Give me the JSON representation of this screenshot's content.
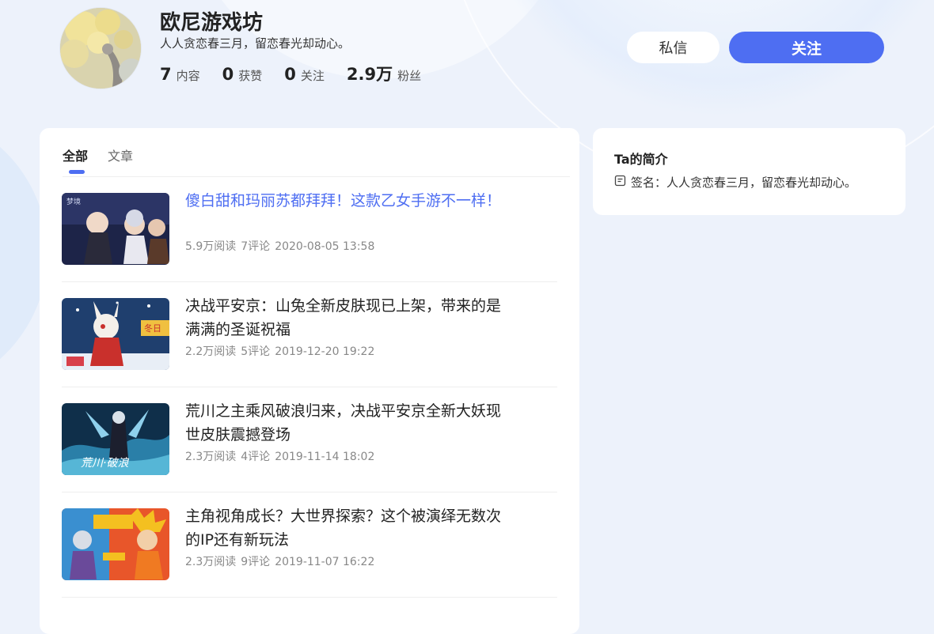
{
  "profile": {
    "name": "欧尼游戏坊",
    "signature": "人人贪恋春三月，留恋春光却动心。",
    "stats": [
      {
        "num": "7",
        "label": "内容"
      },
      {
        "num": "0",
        "label": "获赞"
      },
      {
        "num": "0",
        "label": "关注"
      },
      {
        "num": "2.9万",
        "label": "粉丝"
      }
    ]
  },
  "actions": {
    "message_label": "私信",
    "follow_label": "关注"
  },
  "tabs": [
    {
      "label": "全部",
      "active": true
    },
    {
      "label": "文章",
      "active": false
    }
  ],
  "articles": [
    {
      "title": "傻白甜和玛丽苏都拜拜！这款乙女手游不一样！",
      "reads": "5.9万阅读",
      "comments": "7评论",
      "date": "2020-08-05 13:58",
      "highlighted": true
    },
    {
      "title": "决战平安京：山兔全新皮肤现已上架，带来的是满满的圣诞祝福",
      "reads": "2.2万阅读",
      "comments": "5评论",
      "date": "2019-12-20 19:22",
      "highlighted": false
    },
    {
      "title": "荒川之主乘风破浪归来，决战平安京全新大妖现世皮肤震撼登场",
      "reads": "2.3万阅读",
      "comments": "4评论",
      "date": "2019-11-14 18:02",
      "highlighted": false
    },
    {
      "title": "主角视角成长？大世界探索？这个被演绎无数次的IP还有新玩法",
      "reads": "2.3万阅读",
      "comments": "9评论",
      "date": "2019-11-07 16:22",
      "highlighted": false
    }
  ],
  "sidebar": {
    "title": "Ta的简介",
    "signature_label": "签名：",
    "signature_text": "人人贪恋春三月，留恋春光却动心。",
    "icon": "document-icon"
  },
  "colors": {
    "accent": "#4e6ef2",
    "background": "#edf2fb",
    "card": "#ffffff"
  }
}
